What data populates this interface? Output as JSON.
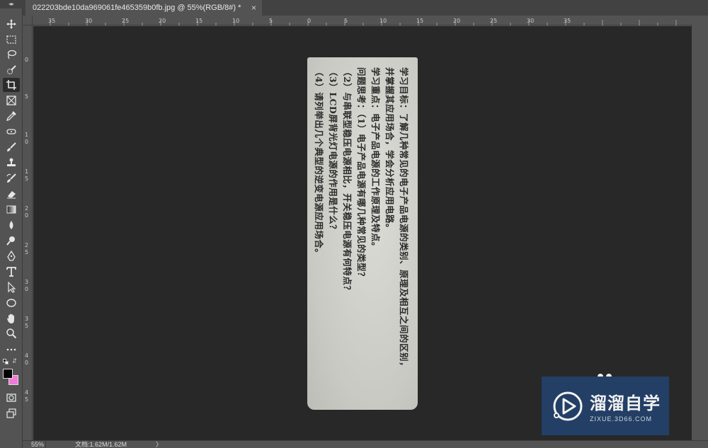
{
  "document_tab": {
    "title": "022203bde10da969061fe465359b0fb.jpg @ 55%(RGB/8#) *",
    "close_glyph": "×"
  },
  "toolbar": {
    "collapse_glyph": "◂▸",
    "tools": [
      {
        "name": "move-tool-icon"
      },
      {
        "name": "marquee-tool-icon"
      },
      {
        "name": "lasso-tool-icon"
      },
      {
        "name": "quick-select-tool-icon"
      },
      {
        "name": "crop-tool-icon",
        "active": true
      },
      {
        "name": "frame-tool-icon"
      },
      {
        "name": "eyedropper-tool-icon"
      },
      {
        "name": "healing-brush-tool-icon"
      },
      {
        "name": "brush-tool-icon"
      },
      {
        "name": "clone-stamp-tool-icon"
      },
      {
        "name": "history-brush-tool-icon"
      },
      {
        "name": "eraser-tool-icon"
      },
      {
        "name": "gradient-tool-icon"
      },
      {
        "name": "blur-tool-icon"
      },
      {
        "name": "dodge-tool-icon"
      },
      {
        "name": "pen-tool-icon"
      },
      {
        "name": "type-tool-icon"
      },
      {
        "name": "path-select-tool-icon"
      },
      {
        "name": "ellipse-tool-icon"
      },
      {
        "name": "hand-tool-icon"
      },
      {
        "name": "zoom-tool-icon"
      },
      {
        "name": "more-tools-icon"
      }
    ],
    "foreground_color": "#000000",
    "background_color": "#f07ad8"
  },
  "rulers": {
    "top_labels": [
      "35",
      "30",
      "25",
      "20",
      "15",
      "10",
      "5",
      "0",
      "5",
      "10",
      "15",
      "20",
      "25",
      "30",
      "35"
    ],
    "left_labels": [
      "0",
      "5",
      "1",
      "0",
      "1",
      "5",
      "2",
      "0",
      "2",
      "5",
      "3",
      "0",
      "3",
      "5",
      "4",
      "0",
      "4",
      "5"
    ]
  },
  "document_image": {
    "lines": [
      "学习目标：了解几种常见的电子产品电源的类别、原理及相互之间的区别，",
      "并掌握其应用场合，学会分析应用电路。",
      "学习重点：电子产品电源的工作原理及特点。",
      "问题思考：（1）电子产品电源有哪几种常见的类型？",
      "（2）与串联型稳压电源相比，开关稳压电源有何特点？",
      "（3）LCD屏背光灯电源的作用是什么？",
      "（4）请列举出几个典型的逆变电源应用场合。"
    ]
  },
  "watermark": {
    "title": "溜溜自学",
    "subtitle": "ZIXUE.3D66.COM",
    "color": "#233f66"
  },
  "status_bar": {
    "zoom": "55%",
    "doc_size": "文档:1.62M/1.62M",
    "arrow": "〉"
  }
}
